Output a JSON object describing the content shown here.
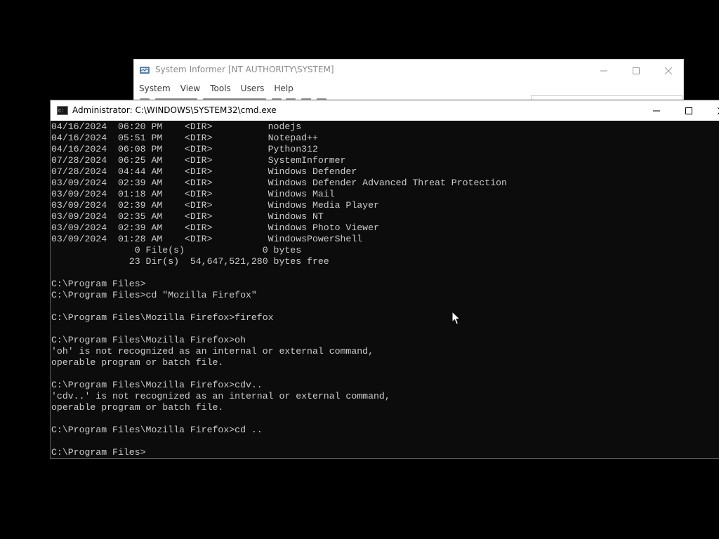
{
  "background_window": {
    "title": "System Informer [NT AUTHORITY\\SYSTEM]",
    "menu": [
      "System",
      "View",
      "Tools",
      "Users",
      "Help"
    ]
  },
  "cmd_window": {
    "title": "Administrator: C:\\WINDOWS\\SYSTEM32\\cmd.exe",
    "console_lines": [
      "04/16/2024  06:20 PM    <DIR>          nodejs",
      "04/16/2024  05:51 PM    <DIR>          Notepad++",
      "04/16/2024  06:08 PM    <DIR>          Python312",
      "07/28/2024  06:25 AM    <DIR>          SystemInformer",
      "07/28/2024  04:44 AM    <DIR>          Windows Defender",
      "03/09/2024  02:39 AM    <DIR>          Windows Defender Advanced Threat Protection",
      "03/09/2024  01:18 AM    <DIR>          Windows Mail",
      "03/09/2024  02:39 AM    <DIR>          Windows Media Player",
      "03/09/2024  02:35 AM    <DIR>          Windows NT",
      "03/09/2024  02:39 AM    <DIR>          Windows Photo Viewer",
      "03/09/2024  01:28 AM    <DIR>          WindowsPowerShell",
      "               0 File(s)              0 bytes",
      "              23 Dir(s)  54,647,521,280 bytes free",
      "",
      "C:\\Program Files>",
      "C:\\Program Files>cd \"Mozilla Firefox\"",
      "",
      "C:\\Program Files\\Mozilla Firefox>firefox",
      "",
      "C:\\Program Files\\Mozilla Firefox>oh",
      "'oh' is not recognized as an internal or external command,",
      "operable program or batch file.",
      "",
      "C:\\Program Files\\Mozilla Firefox>cdv..",
      "'cdv..' is not recognized as an internal or external command,",
      "operable program or batch file.",
      "",
      "C:\\Program Files\\Mozilla Firefox>cd ..",
      "",
      "C:\\Program Files>"
    ]
  },
  "icons": {
    "si_app": "system-informer-icon",
    "cmd_app": "cmd-icon",
    "minimize": "minimize-icon",
    "maximize": "maximize-icon",
    "close": "close-icon",
    "cursor": "mouse-cursor-icon"
  },
  "colors": {
    "desktop": "#000000",
    "console_bg": "#0c0c0c",
    "console_text": "#cccccc",
    "titlebar": "#ffffff",
    "inactive_title_text": "#8a8a8a"
  }
}
